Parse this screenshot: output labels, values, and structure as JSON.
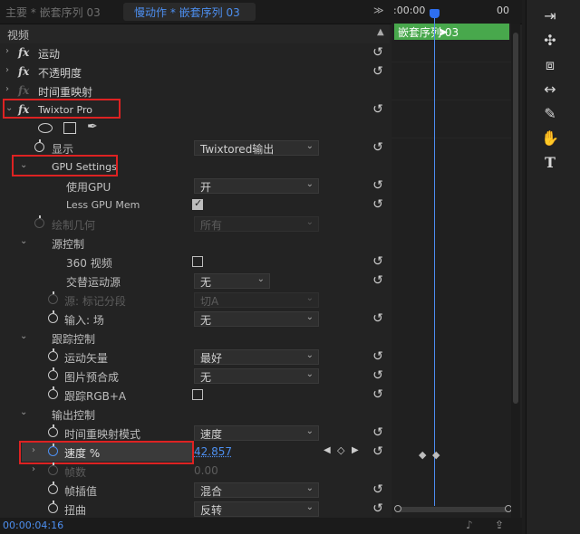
{
  "tabs": {
    "inactive": "主要 * 嵌套序列 03",
    "active": "慢动作 * 嵌套序列 03"
  },
  "header": {
    "label": "视频"
  },
  "rows": {
    "motion": "运动",
    "opacity": "不透明度",
    "time_remap": "时间重映射",
    "plugin": "Twixtor Pro",
    "display_label": "显示",
    "display_value": "Twixtored输出",
    "gpu_settings": "GPU Settings",
    "use_gpu_label": "使用GPU",
    "use_gpu_value": "开",
    "less_gpu_mem": "Less GPU Mem",
    "draw_geometry_label": "绘制几何",
    "draw_geometry_value": "所有",
    "source_control": "源控制",
    "video_360": "360 视频",
    "alt_motion_label": "交替运动源",
    "alt_motion_value": "无",
    "source_markers_label": "源: 标记分段",
    "source_markers_value": "切A",
    "input_field_label": "输入: 场",
    "input_field_value": "无",
    "tracking_control": "跟踪控制",
    "motion_vectors_label": "运动矢量",
    "motion_vectors_value": "最好",
    "image_prep_label": "图片预合成",
    "image_prep_value": "无",
    "track_rgba": "跟踪RGB+A",
    "output_control": "输出控制",
    "time_remap_mode_label": "时间重映射模式",
    "time_remap_mode_value": "速度",
    "speed_label": "速度 %",
    "speed_value": "42.857",
    "frames_label": "帧数",
    "frames_value": "0.00",
    "frame_interp_label": "帧插值",
    "frame_interp_value": "混合",
    "warp_label": "扭曲",
    "warp_value": "反转"
  },
  "timeline": {
    "ruler_start": ":00:00",
    "ruler_end": "00",
    "clip_label": "嵌套序列 03"
  },
  "footer": {
    "timecode": "00:00:04:16"
  },
  "icons": {
    "reset": "reset-icon",
    "accent": "#4d8ff0",
    "clip_color": "#48a84c",
    "highlight_color": "#dd2222"
  }
}
